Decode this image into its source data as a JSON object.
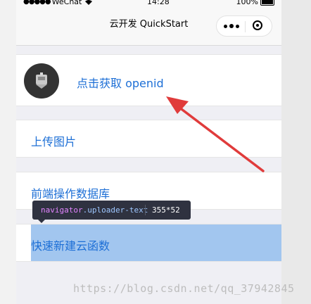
{
  "status_bar": {
    "carrier": "WeChat",
    "time": "14:28",
    "battery": "100%"
  },
  "nav_bar": {
    "title": "云开发 QuickStart"
  },
  "list": {
    "openid_label": "点击获取 openid",
    "upload_label": "上传图片",
    "db_label": "前端操作数据库",
    "cloud_fn_label": "快速新建云函数"
  },
  "inspector_tooltip": {
    "tag": "navigator",
    "class": ".uploader-text",
    "size": "355*52"
  },
  "watermark": {
    "text": "https://blog.csdn.net/qq_37942845"
  },
  "colors": {
    "link_blue": "#1d6fd6",
    "highlight_blue": "#a2c6ef",
    "arrow_red": "#e03b3b",
    "tooltip_bg": "#2f3240"
  }
}
